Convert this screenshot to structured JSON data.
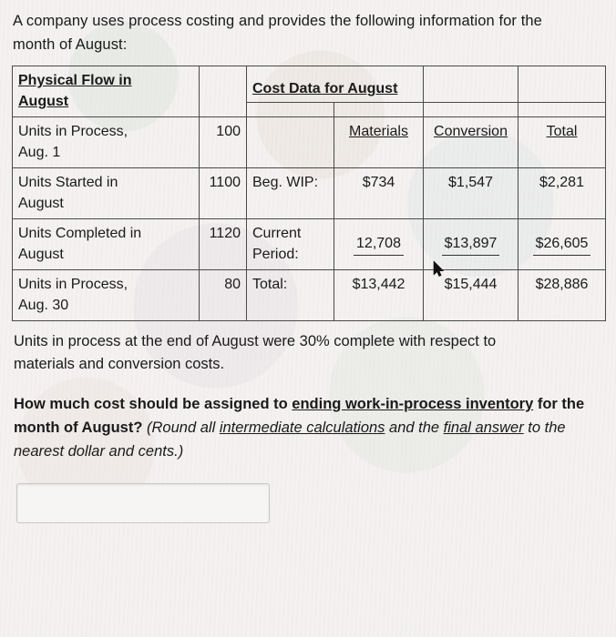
{
  "intro": {
    "line1": "A company uses process costing and provides the following information for the",
    "line2": "month of August:"
  },
  "flow_table": {
    "physical_header_line1": "Physical Flow in",
    "physical_header_line2": "August",
    "cost_header": "Cost Data for August",
    "col_materials": "Materials",
    "col_conversion": "Conversion",
    "col_total": "Total",
    "rows": [
      {
        "flow_label_line1": "Units in Process,",
        "flow_label_line2": "Aug. 1",
        "flow_value": "100",
        "cost_label": "",
        "materials": "Materials",
        "conversion": "Conversion",
        "total": "Total"
      },
      {
        "flow_label_line1": "Units Started in",
        "flow_label_line2": "August",
        "flow_value": "1100",
        "cost_label": "Beg. WIP:",
        "materials": "$734",
        "conversion": "$1,547",
        "total": "$2,281"
      },
      {
        "flow_label_line1": "Units Completed in",
        "flow_label_line2": "August",
        "flow_value": "1120",
        "cost_label_line1": "Current",
        "cost_label_line2": "Period:",
        "materials": "12,708",
        "conversion": "$13,897",
        "total": "$26,605"
      },
      {
        "flow_label_line1": "Units in Process,",
        "flow_label_line2": "Aug. 30",
        "flow_value": "80",
        "cost_label": "Total:",
        "materials": "$13,442",
        "conversion": "$15,444",
        "total": "$28,886"
      }
    ]
  },
  "note": {
    "line1": "Units in process at the end of August were 30% complete with respect to",
    "line2": "materials and conversion costs."
  },
  "question": {
    "part1": "How much cost should be assigned to ",
    "underlined1": "ending work-in-process inventory",
    "part2": " for the",
    "part3": "month of August?",
    "paren_open": " (Round all ",
    "underlined2": "intermediate calculations",
    "paren_mid": " and the ",
    "underlined3": "final answer",
    "paren_end": " to the",
    "paren_last_line": "nearest dollar and cents.)"
  },
  "answer_input": {
    "value": "",
    "placeholder": ""
  }
}
